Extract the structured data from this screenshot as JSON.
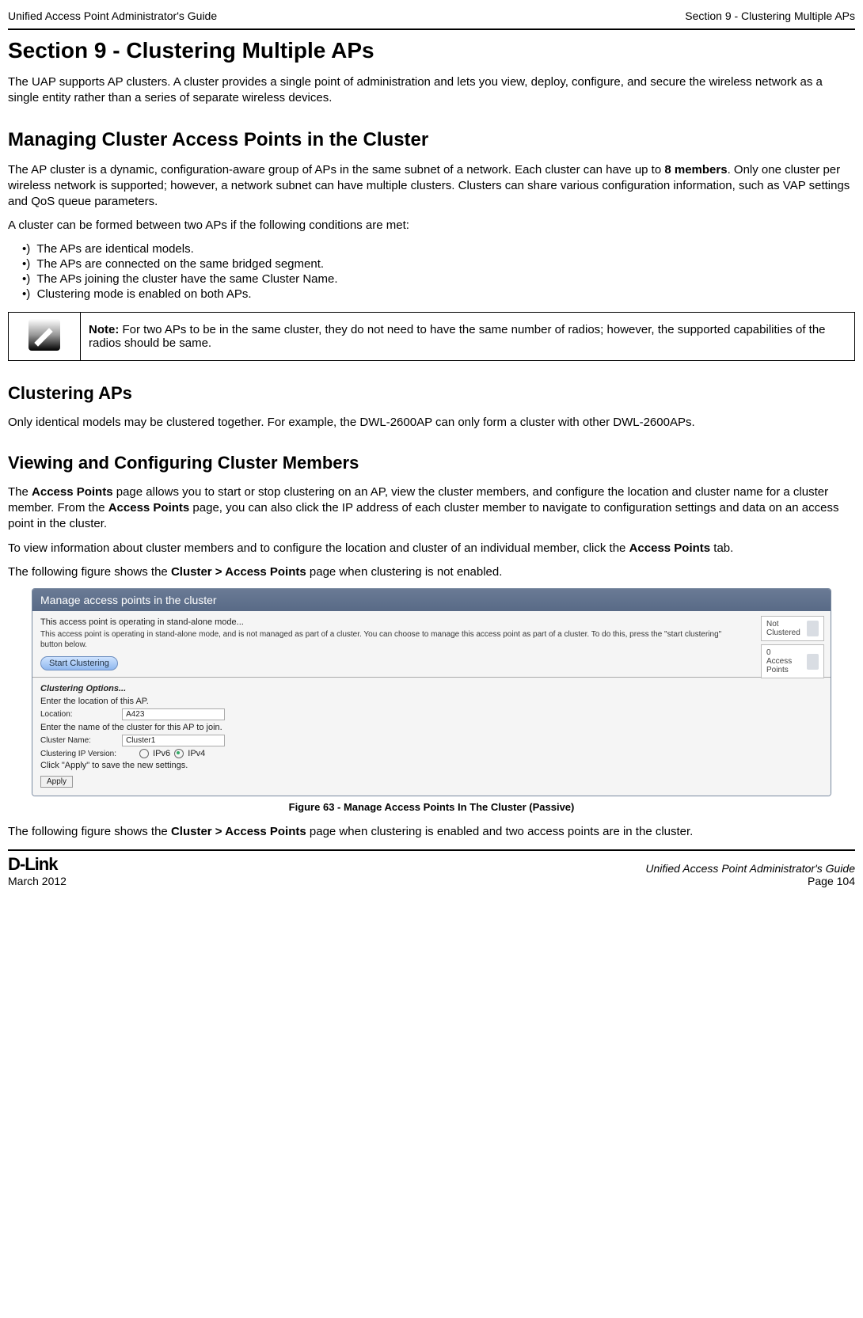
{
  "top": {
    "left": "Unified Access Point Administrator's Guide",
    "right": "Section 9 - Clustering Multiple APs"
  },
  "headings": {
    "h1": "Section 9 - Clustering Multiple APs",
    "h2": "Managing Cluster Access Points in the Cluster",
    "h3a": "Clustering APs",
    "h3b": "Viewing and Configuring Cluster Members"
  },
  "paragraphs": {
    "intro": "The UAP supports AP clusters. A cluster provides a single point of administration and lets you view, deploy, configure, and secure the wireless network as a single entity rather than a series of separate wireless devices.",
    "managing1a": "The AP cluster is a dynamic, configuration-aware group of APs in the same subnet of a network. Each cluster can have up to ",
    "managing1b": "8 members",
    "managing1c": ". Only one cluster per wireless network is supported; however, a network subnet can have multiple clusters. Clusters can share various configuration information, such as VAP settings and QoS queue parameters.",
    "conditionsIntro": "A cluster can be formed between two APs if the following conditions are met:",
    "clusteringAPs": "Only identical models may be clustered together. For example, the DWL-2600AP can only form a cluster with other DWL-2600APs.",
    "viewing1a": "The ",
    "viewing1b": "Access Points",
    "viewing1c": " page allows you to start or stop clustering on an AP, view the cluster members, and configure the location and cluster name for a cluster member. From the ",
    "viewing1d": "Access Points",
    "viewing1e": " page, you can also click the IP address of each cluster member to navigate to configuration settings and data on an access point in the cluster.",
    "viewing2a": "To view information about cluster members and to configure the location and cluster of an individual member, click the ",
    "viewing2b": "Access Points",
    "viewing2c": " tab.",
    "viewing3a": "The following figure shows the ",
    "viewing3b": "Cluster > Access Points",
    "viewing3c": " page when clustering is not enabled.",
    "afterFig1a": "The following figure shows the ",
    "afterFig1b": "Cluster > Access Points",
    "afterFig1c": " page when clustering is enabled and two access points are in the cluster."
  },
  "bullets": [
    "The APs are identical models.",
    "The APs are connected on the same bridged segment.",
    "The APs joining the cluster have the same Cluster Name.",
    "Clustering mode is enabled on both APs."
  ],
  "note": {
    "label": "Note:",
    "text": " For two APs to be in the same cluster, they do not need to have the same number of radios; however, the supported capabilities of the radios should be same."
  },
  "figure": {
    "titleBar": "Manage access points in the cluster",
    "alertLine": "This access point is operating in stand-alone mode...",
    "desc": "This access point is operating in stand-alone mode, and is not managed as part of a cluster. You can choose to manage this access point as part of a cluster. To do this, press the \"start clustering\" button below.",
    "startButton": "Start Clustering",
    "side": {
      "notClustered": "Not Clustered",
      "zero": "0",
      "accessPoints": "Access Points"
    },
    "sectionLabel": "Clustering Options...",
    "enterLocation": "Enter the location of this AP.",
    "locationLabel": "Location:",
    "locationValue": "A423",
    "enterClusterName": "Enter the name of the cluster for this AP to join.",
    "clusterNameLabel": "Cluster Name:",
    "clusterNameValue": "Cluster1",
    "ipVersionLabel": "Clustering IP Version:",
    "ipv6": "IPv6",
    "ipv4": "IPv4",
    "applyHint": "Click \"Apply\" to save the new settings.",
    "applyButton": "Apply",
    "caption": "Figure 63 - Manage Access Points In The Cluster (Passive)"
  },
  "footer": {
    "logo": "D-Link",
    "date": "March 2012",
    "titleItalic": "Unified Access Point Administrator's Guide",
    "page": "Page 104"
  }
}
